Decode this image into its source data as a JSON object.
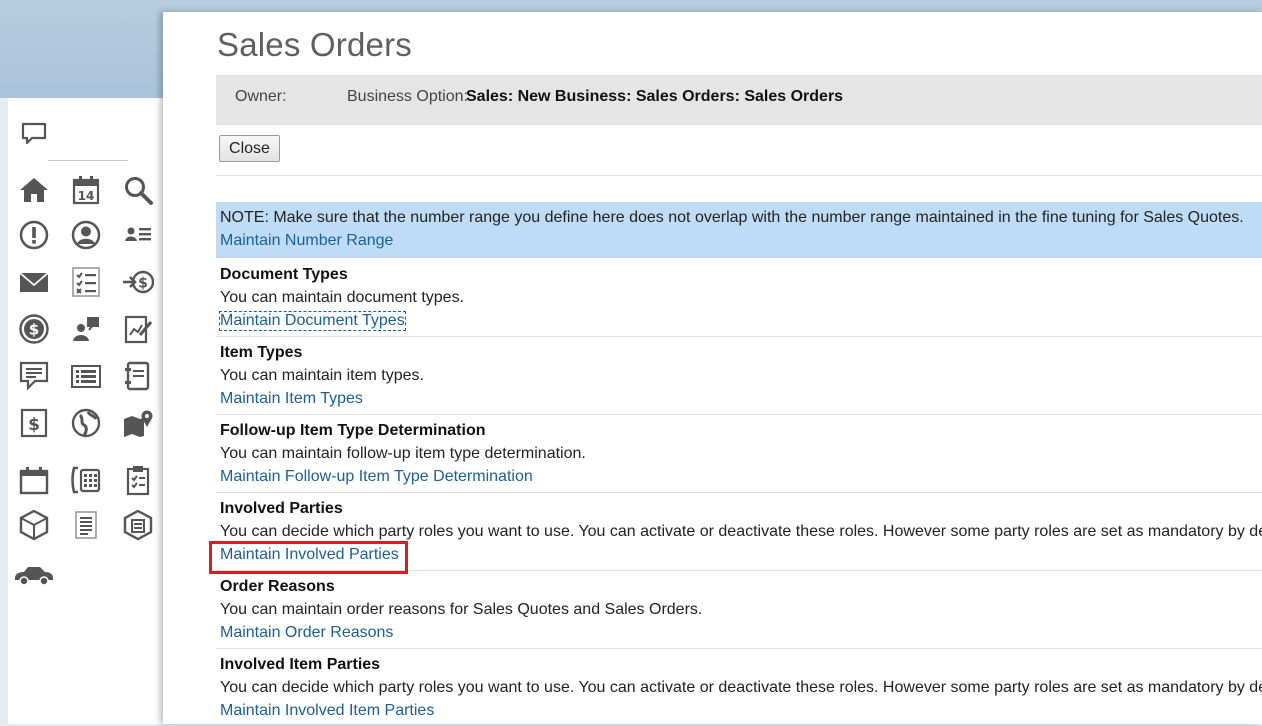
{
  "page": {
    "title": "Sales Orders"
  },
  "owner_bar": {
    "owner_label": "Owner:",
    "business_option_label": "Business Option:",
    "business_option_value": "Sales: New Business: Sales Orders: Sales Orders"
  },
  "toolbar": {
    "close_label": "Close"
  },
  "note": {
    "text": "NOTE: Make sure that the number range you define here does not overlap with the number range maintained in the fine tuning for Sales Quotes.",
    "link": "Maintain Number Range"
  },
  "sections": [
    {
      "title": "Document Types",
      "description": "You can maintain document types.",
      "link": "Maintain Document Types"
    },
    {
      "title": "Item Types",
      "description": "You can maintain item types.",
      "link": "Maintain Item Types"
    },
    {
      "title": "Follow-up Item Type Determination",
      "description": "You can maintain follow-up item type determination.",
      "link": "Maintain Follow-up Item Type Determination"
    },
    {
      "title": "Involved Parties",
      "description": "You can decide which party roles you want to use. You can activate or deactivate these roles. However some party roles are set as mandatory by defau",
      "link": "Maintain Involved Parties"
    },
    {
      "title": "Order Reasons",
      "description": "You can maintain order reasons for Sales Quotes and Sales Orders.",
      "link": "Maintain Order Reasons"
    },
    {
      "title": "Involved Item Parties",
      "description": "You can decide which party roles you want to use. You can activate or deactivate these roles. However some party roles are set as mandatory by defau",
      "link": "Maintain Involved Item Parties"
    }
  ],
  "sidebar": {
    "icons": [
      "feed-icon",
      "home-icon",
      "calendar-icon",
      "search-icon",
      "alert-icon",
      "profile-icon",
      "contacts-icon",
      "mail-icon",
      "checklist-icon",
      "incoming-payment-icon",
      "money-icon",
      "team-icon",
      "report-icon",
      "quote-icon",
      "list-icon",
      "notebook-icon",
      "invoice-icon",
      "globe-icon",
      "map-icon",
      "schedule-icon",
      "phone-icon",
      "clipboard-icon",
      "product-icon",
      "document-list-icon",
      "catalog-icon",
      "car-icon"
    ]
  },
  "colors": {
    "link": "#1a5f96",
    "note_background": "#bfdcf7",
    "highlight": "#d6201f"
  }
}
